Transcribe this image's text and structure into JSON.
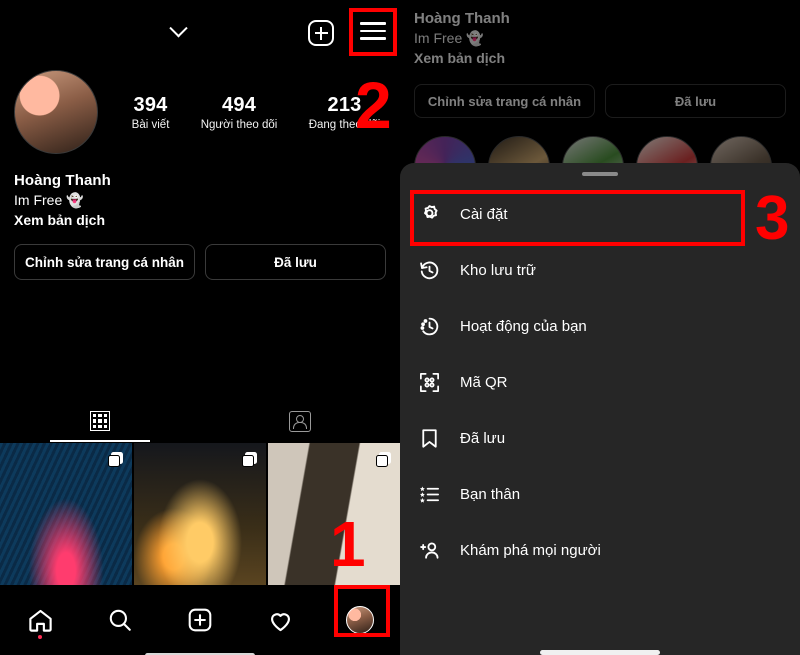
{
  "left_panel": {
    "topbar": {
      "chevron_icon": "chevron-down-icon",
      "add_icon": "plus-box-icon",
      "menu_icon": "hamburger-menu-icon"
    },
    "profile": {
      "avatar": "profile-avatar",
      "name": "Hoàng Thanh",
      "bio": "Im Free 👻",
      "translate_link": "Xem bản dịch",
      "stats": [
        {
          "value": "394",
          "label": "Bài viết"
        },
        {
          "value": "494",
          "label": "Người theo dõi"
        },
        {
          "value": "213",
          "label": "Đang theo dõi"
        }
      ],
      "buttons": [
        {
          "label": "Chỉnh sửa trang cá nhân"
        },
        {
          "label": "Đã lưu"
        }
      ]
    },
    "tabs": [
      {
        "name": "grid-tab",
        "icon": "grid-icon",
        "active": true
      },
      {
        "name": "tagged-tab",
        "icon": "tagged-person-icon",
        "active": false
      }
    ],
    "posts": [
      {
        "name": "post-thumbnail-1",
        "badge": "carousel-icon"
      },
      {
        "name": "post-thumbnail-2",
        "badge": "carousel-icon"
      },
      {
        "name": "post-thumbnail-3",
        "badge": "carousel-icon"
      }
    ],
    "bottom_nav": [
      {
        "name": "nav-home",
        "icon": "home-icon",
        "has_dot": true
      },
      {
        "name": "nav-search",
        "icon": "search-icon",
        "has_dot": false
      },
      {
        "name": "nav-create",
        "icon": "plus-box-icon",
        "has_dot": false
      },
      {
        "name": "nav-activity",
        "icon": "heart-icon",
        "has_dot": false
      },
      {
        "name": "nav-profile",
        "icon": "avatar-icon",
        "has_dot": false
      }
    ]
  },
  "right_panel": {
    "profile": {
      "name": "Hoàng Thanh",
      "bio": "Im Free 👻",
      "translate_link": "Xem bản dịch",
      "buttons": [
        {
          "label": "Chỉnh sửa trang cá nhân"
        },
        {
          "label": "Đã lưu"
        }
      ]
    },
    "sheet": {
      "grabber": "drag-handle",
      "menu_items": [
        {
          "icon": "gear-icon",
          "label": "Cài đặt"
        },
        {
          "icon": "archive-clock-icon",
          "label": "Kho lưu trữ"
        },
        {
          "icon": "activity-clock-icon",
          "label": "Hoạt động của bạn"
        },
        {
          "icon": "qr-code-icon",
          "label": "Mã QR"
        },
        {
          "icon": "bookmark-icon",
          "label": "Đã lưu"
        },
        {
          "icon": "star-list-icon",
          "label": "Bạn thân"
        },
        {
          "icon": "add-person-icon",
          "label": "Khám phá mọi người"
        }
      ]
    }
  },
  "annotations": [
    {
      "number": "1",
      "target": "nav-profile"
    },
    {
      "number": "2",
      "target": "hamburger-menu-icon"
    },
    {
      "number": "3",
      "target": "settings-menu-item"
    }
  ],
  "colors": {
    "annotation_red": "#FF0000",
    "background": "#000000",
    "sheet_background": "#262626"
  }
}
